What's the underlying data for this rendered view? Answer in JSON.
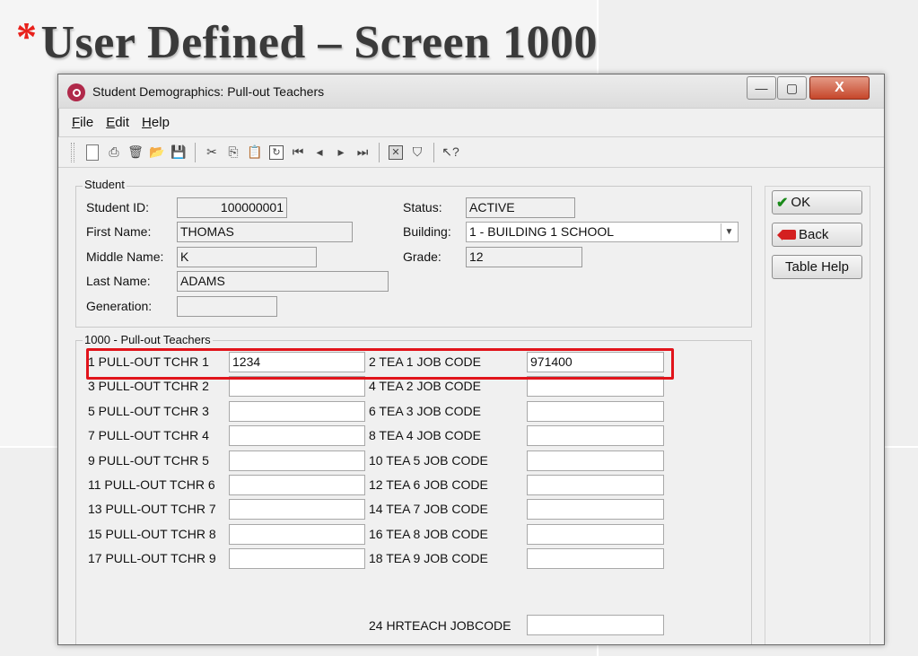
{
  "slide": {
    "bullet": "*",
    "title": "User Defined – Screen 1000"
  },
  "window": {
    "title": "Student Demographics: Pull-out Teachers",
    "min_symbol": "—",
    "max_symbol": "▢",
    "close_symbol": "X"
  },
  "menu": [
    "File",
    "Edit",
    "Help"
  ],
  "student": {
    "group_label": "Student",
    "id_label": "Student ID:",
    "id_value": "100000001",
    "first_label": "First Name:",
    "first_value": "THOMAS",
    "middle_label": "Middle Name:",
    "middle_value": "K",
    "last_label": "Last Name:",
    "last_value": "ADAMS",
    "generation_label": "Generation:",
    "generation_value": "",
    "status_label": "Status:",
    "status_value": "ACTIVE",
    "building_label": "Building:",
    "building_value": "1 - BUILDING 1 SCHOOL",
    "grade_label": "Grade:",
    "grade_value": "12"
  },
  "buttons": {
    "ok": "OK",
    "back": "Back",
    "table_help": "Table Help"
  },
  "pullout": {
    "group_label": "1000 - Pull-out Teachers",
    "rows": [
      {
        "left_label": "1  PULL-OUT TCHR 1",
        "left_value": "1234",
        "right_label": "2  TEA 1 JOB CODE",
        "right_value": "971400"
      },
      {
        "left_label": "3  PULL-OUT TCHR 2",
        "left_value": "",
        "right_label": "4  TEA 2 JOB CODE",
        "right_value": ""
      },
      {
        "left_label": "5  PULL-OUT TCHR 3",
        "left_value": "",
        "right_label": "6  TEA 3 JOB CODE",
        "right_value": ""
      },
      {
        "left_label": "7  PULL-OUT TCHR 4",
        "left_value": "",
        "right_label": "8  TEA 4 JOB CODE",
        "right_value": ""
      },
      {
        "left_label": "9  PULL-OUT TCHR 5",
        "left_value": "",
        "right_label": "10 TEA 5 JOB CODE",
        "right_value": ""
      },
      {
        "left_label": "11 PULL-OUT TCHR 6",
        "left_value": "",
        "right_label": "12 TEA 6 JOB CODE",
        "right_value": ""
      },
      {
        "left_label": "13 PULL-OUT TCHR 7",
        "left_value": "",
        "right_label": "14 TEA 7 JOB CODE",
        "right_value": ""
      },
      {
        "left_label": "15 PULL-OUT TCHR 8",
        "left_value": "",
        "right_label": "16 TEA 8 JOB CODE",
        "right_value": ""
      },
      {
        "left_label": "17 PULL-OUT TCHR 9",
        "left_value": "",
        "right_label": "18 TEA 9 JOB CODE",
        "right_value": ""
      }
    ],
    "hrteach_label": "24 HRTEACH JOBCODE",
    "hrteach_value": ""
  },
  "colors": {
    "highlight": "#e1141b",
    "title_star": "#e8211c",
    "app_icon": "#b0294a"
  }
}
